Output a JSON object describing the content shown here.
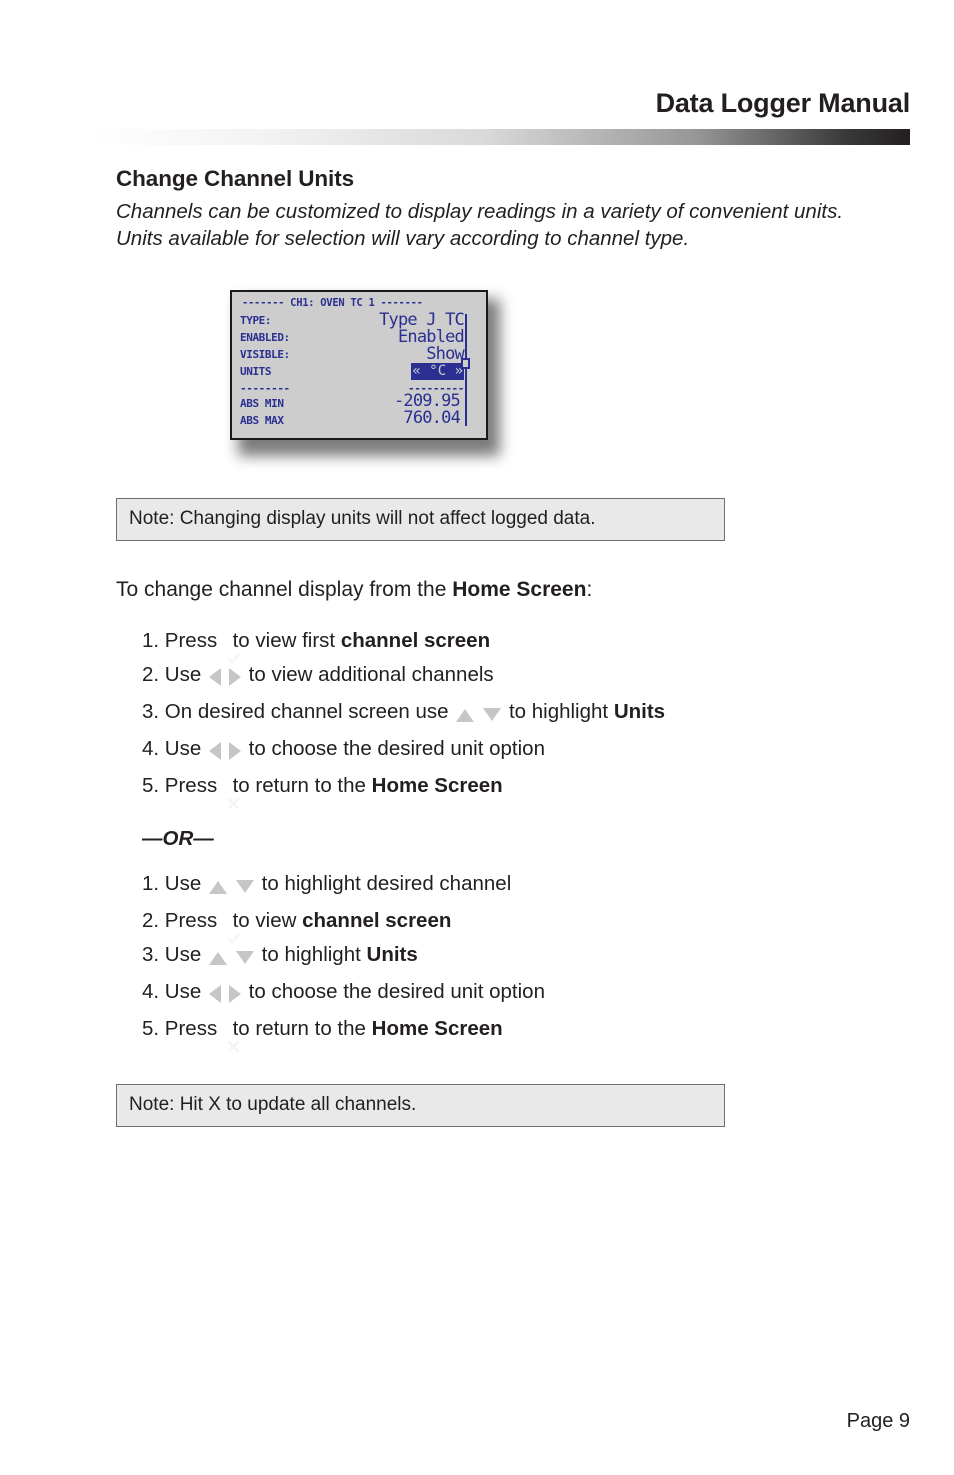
{
  "header": {
    "title": "Data Logger Manual"
  },
  "section": {
    "heading": "Change Channel Units",
    "intro": "Channels can be customized to display readings in a variety of convenient units. Units available for selection will vary according to channel type."
  },
  "lcd": {
    "title": "------- CH1: OVEN TC 1 -------",
    "rows": [
      {
        "label": "TYPE:",
        "value": "Type J TC",
        "selected": false
      },
      {
        "label": "ENABLED:",
        "value": "Enabled",
        "selected": false
      },
      {
        "label": "VISIBLE:",
        "value": "Show",
        "selected": false
      },
      {
        "label": "UNITS",
        "value": "« °C »",
        "selected": true
      }
    ],
    "separator_left": "--------",
    "separator_right": "---------",
    "stats": [
      {
        "label": "ABS MIN",
        "value": "-209.95"
      },
      {
        "label": "ABS MAX",
        "value": "760.04"
      }
    ],
    "scrollbar_name": "lcd-scrollbar"
  },
  "notes": {
    "top": "Note: Changing display units will not affect logged data.",
    "bottom": "Note: Hit X to update all channels."
  },
  "procedure": {
    "lead_prefix": "To change channel display from the ",
    "lead_bold": "Home Screen",
    "lead_suffix": ":",
    "or_divider": "—OR—",
    "list_one": [
      {
        "number": "1.",
        "parts": [
          {
            "type": "text",
            "text": "Press "
          },
          {
            "type": "icon",
            "icon": "check-key-icon"
          },
          {
            "type": "text",
            "text": " to view first "
          },
          {
            "type": "bold",
            "text": "channel screen"
          }
        ]
      },
      {
        "number": "2.",
        "parts": [
          {
            "type": "text",
            "text": "Use "
          },
          {
            "type": "icon",
            "icon": "left-arrow-key-icon"
          },
          {
            "type": "icon",
            "icon": "right-arrow-key-icon"
          },
          {
            "type": "text",
            "text": " to view additional channels"
          }
        ]
      },
      {
        "number": "3.",
        "parts": [
          {
            "type": "text",
            "text": "On desired channel screen use "
          },
          {
            "type": "icon",
            "icon": "up-arrow-key-icon"
          },
          {
            "type": "icon",
            "icon": "down-arrow-key-icon"
          },
          {
            "type": "text",
            "text": " to highlight "
          },
          {
            "type": "bold",
            "text": "Units"
          }
        ]
      },
      {
        "number": "4.",
        "parts": [
          {
            "type": "text",
            "text": "Use "
          },
          {
            "type": "icon",
            "icon": "left-arrow-key-icon"
          },
          {
            "type": "icon",
            "icon": "right-arrow-key-icon"
          },
          {
            "type": "text",
            "text": " to choose the desired unit option"
          }
        ]
      },
      {
        "number": "5.",
        "parts": [
          {
            "type": "text",
            "text": "Press "
          },
          {
            "type": "icon",
            "icon": "x-key-icon"
          },
          {
            "type": "text",
            "text": " to return to the "
          },
          {
            "type": "bold",
            "text": "Home Screen"
          }
        ]
      }
    ],
    "list_two": [
      {
        "number": "1.",
        "parts": [
          {
            "type": "text",
            "text": "Use "
          },
          {
            "type": "icon",
            "icon": "up-arrow-key-icon"
          },
          {
            "type": "icon",
            "icon": "down-arrow-key-icon"
          },
          {
            "type": "text",
            "text": " to highlight desired channel"
          }
        ]
      },
      {
        "number": "2.",
        "parts": [
          {
            "type": "text",
            "text": "Press "
          },
          {
            "type": "icon",
            "icon": "check-key-icon"
          },
          {
            "type": "text",
            "text": " to view "
          },
          {
            "type": "bold",
            "text": "channel screen"
          }
        ]
      },
      {
        "number": "3.",
        "parts": [
          {
            "type": "text",
            "text": "Use "
          },
          {
            "type": "icon",
            "icon": "up-arrow-key-icon"
          },
          {
            "type": "icon",
            "icon": "down-arrow-key-icon"
          },
          {
            "type": "text",
            "text": " to highlight "
          },
          {
            "type": "bold",
            "text": "Units"
          }
        ]
      },
      {
        "number": "4.",
        "parts": [
          {
            "type": "text",
            "text": "Use "
          },
          {
            "type": "icon",
            "icon": "left-arrow-key-icon"
          },
          {
            "type": "icon",
            "icon": "right-arrow-key-icon"
          },
          {
            "type": "text",
            "text": " to choose the desired unit option"
          }
        ]
      },
      {
        "number": "5.",
        "parts": [
          {
            "type": "text",
            "text": "Press "
          },
          {
            "type": "icon",
            "icon": "x-key-icon"
          },
          {
            "type": "text",
            "text": " to return to the "
          },
          {
            "type": "bold",
            "text": "Home Screen"
          }
        ]
      }
    ]
  },
  "footer": {
    "page_label": "Page 9"
  },
  "colors": {
    "text": "#231f20",
    "lcd_background": "#cdcdcd",
    "lcd_ink": "#2a2f91",
    "note_background": "#e9e9e9",
    "note_border": "#6d6d6d",
    "key_icon": "#c6c6c6"
  }
}
